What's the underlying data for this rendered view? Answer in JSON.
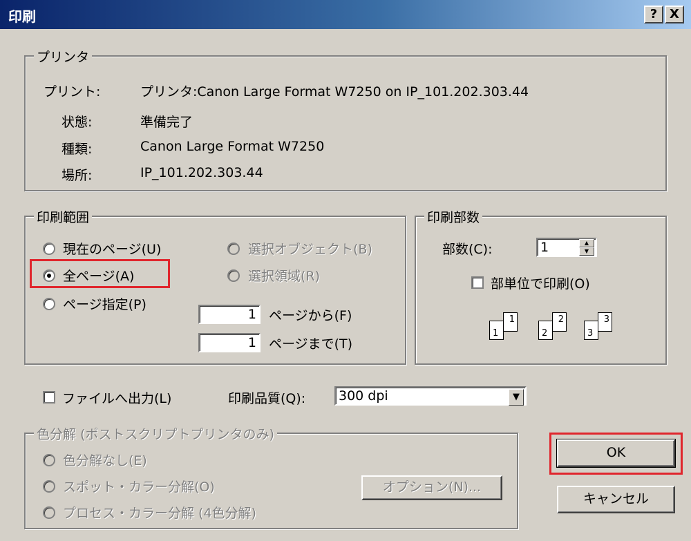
{
  "window": {
    "title": "印刷",
    "help_label": "?",
    "close_label": "X"
  },
  "printer_group": {
    "title": "プリンタ",
    "print_label": "プリント:",
    "print_value": "プリンタ:Canon Large Format W7250 on IP_101.202.303.44",
    "status_label": "状態:",
    "status_value": "準備完了",
    "type_label": "種類:",
    "type_value": "Canon Large Format W7250",
    "location_label": "場所:",
    "location_value": "IP_101.202.303.44"
  },
  "range_group": {
    "title": "印刷範囲",
    "current_page": "現在のページ(U)",
    "selected_objects": "選択オブジェクト(B)",
    "all_pages": "全ページ(A)",
    "selected_area": "選択領域(R)",
    "page_range": "ページ指定(P)",
    "from_value": "1",
    "from_label": "ページから(F)",
    "to_value": "1",
    "to_label": "ページまで(T)",
    "selected": "all_pages"
  },
  "copies_group": {
    "title": "印刷部数",
    "copies_label": "部数(C):",
    "copies_value": "1",
    "collate_label": "部単位で印刷(O)",
    "collate_checked": false,
    "collate_pages": [
      "1",
      "1",
      "2",
      "2",
      "3",
      "3"
    ]
  },
  "output": {
    "print_to_file_label": "ファイルへ出力(L)",
    "print_to_file_checked": false,
    "quality_label": "印刷品質(Q):",
    "quality_value": "300 dpi"
  },
  "separation_group": {
    "title": "色分解 (ポストスクリプトプリンタのみ)",
    "none": "色分解なし(E)",
    "spot": "スポット・カラー分解(O)",
    "process": "プロセス・カラー分解 (4色分解)",
    "options_button": "オプション(N)..."
  },
  "buttons": {
    "ok": "OK",
    "cancel": "キャンセル"
  },
  "colors": {
    "title_bar_start": "#0a246a",
    "title_bar_end": "#a6caf0",
    "dialog_bg": "#d4d0c8",
    "highlight": "#e0262d"
  }
}
